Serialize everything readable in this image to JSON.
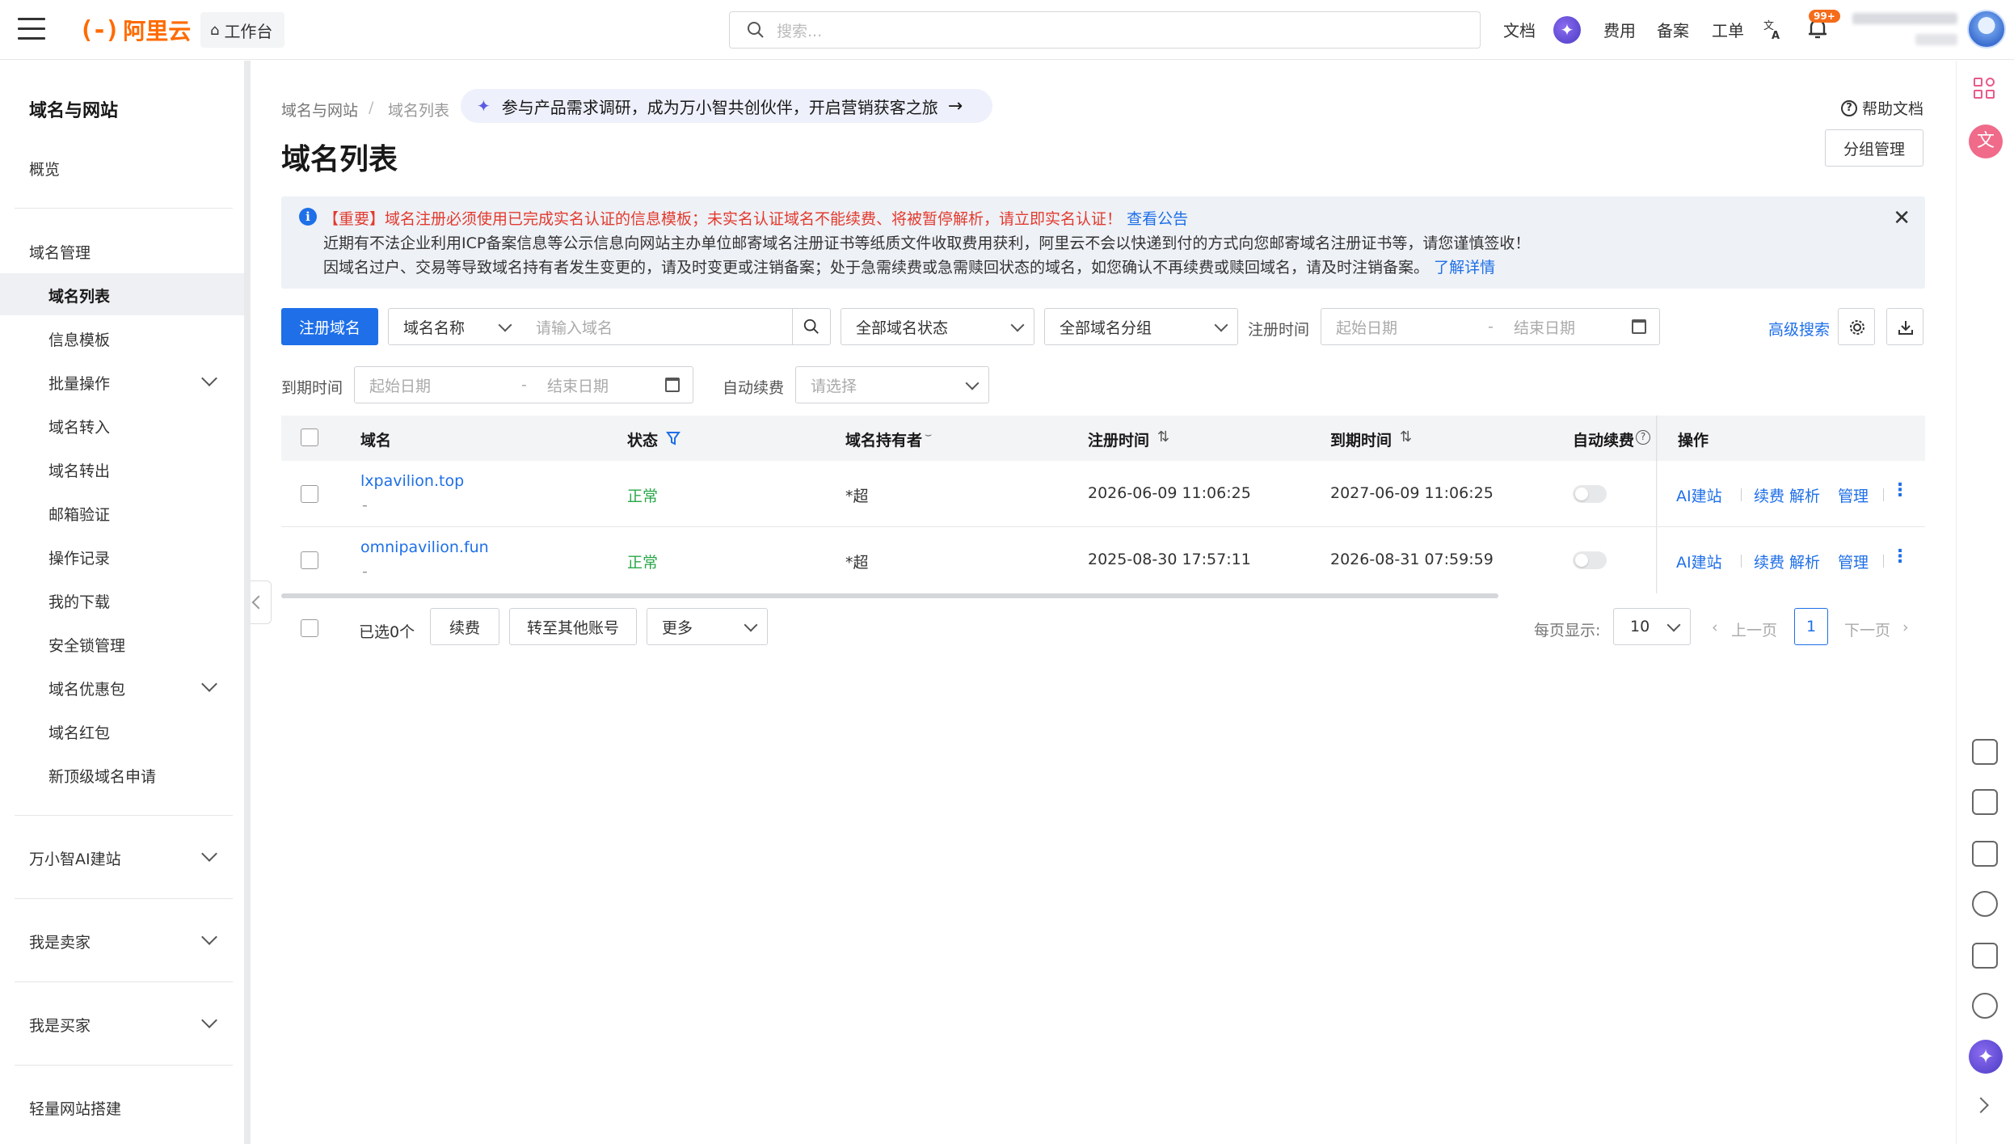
{
  "topbar": {
    "brand": "阿里云",
    "brand_mark": "(-)",
    "workbench": "工作台",
    "search_placeholder": "搜索...",
    "nav": [
      "文档",
      "费用",
      "备案",
      "工单"
    ],
    "bell_badge": "99+"
  },
  "sidebar": {
    "title": "域名与网站",
    "overview": "概览",
    "section_domain": "域名管理",
    "items": [
      "域名列表",
      "信息模板",
      "批量操作",
      "域名转入",
      "域名转出",
      "邮箱验证",
      "操作记录",
      "我的下载",
      "安全锁管理",
      "域名优惠包",
      "域名红包",
      "新顶级域名申请"
    ],
    "groups": [
      "万小智AI建站",
      "我是卖家",
      "我是买家",
      "轻量网站搭建"
    ]
  },
  "main": {
    "breadcrumb": [
      "域名与网站",
      "域名列表"
    ],
    "promo": "参与产品需求调研，成为万小智共创伙伴，开启营销获客之旅",
    "title": "域名列表",
    "help": "帮助文档",
    "group_manage": "分组管理",
    "notice": {
      "line1": "【重要】域名注册必须使用已完成实名认证的信息模板；未实名认证域名不能续费、将被暂停解析，请立即实名认证！",
      "line1_link": "查看公告",
      "line2": "近期有不法企业利用ICP备案信息等公示信息向网站主办单位邮寄域名注册证书等纸质文件收取费用获利，阿里云不会以快递到付的方式向您邮寄域名注册证书等，请您谨慎签收！",
      "line3": "因域名过户、交易等导致域名持有者发生变更的，请及时变更或注销备案；处于急需续费或急需赎回状态的域名，如您确认不再续费或赎回域名，请及时注销备案。",
      "line3_link": "了解详情"
    },
    "filters": {
      "register_btn": "注册域名",
      "search_type": "域名名称",
      "search_placeholder": "请输入域名",
      "status": "全部域名状态",
      "group": "全部域名分组",
      "reg_time_label": "注册时间",
      "start_date": "起始日期",
      "end_date": "结束日期",
      "date_sep": "-",
      "advanced": "高级搜索",
      "expire_label": "到期时间",
      "auto_renew_label": "自动续费",
      "auto_renew_placeholder": "请选择"
    },
    "table": {
      "headers": [
        "域名",
        "状态",
        "域名持有者",
        "注册时间",
        "到期时间",
        "自动续费",
        "操作"
      ],
      "rows": [
        {
          "domain": "lxpavilion.top",
          "sub": "-",
          "status": "正常",
          "owner": "*超",
          "reg": "2026-06-09 11:06:25",
          "exp": "2027-06-09 11:06:25"
        },
        {
          "domain": "omnipavilion.fun",
          "sub": "-",
          "status": "正常",
          "owner": "*超",
          "reg": "2025-08-30 17:57:11",
          "exp": "2026-08-31 07:59:59"
        }
      ],
      "ops": [
        "AI建站",
        "续费",
        "解析",
        "管理"
      ]
    },
    "footer": {
      "selected": "已选0个",
      "renew": "续费",
      "transfer": "转至其他账号",
      "more": "更多",
      "page_size_label": "每页显示:",
      "page_size": "10",
      "prev": "上一页",
      "page": "1",
      "next": "下一页"
    }
  },
  "colors": {
    "brand": "#ff6a00",
    "primary": "#1e6fe8",
    "ok": "#2aa84a",
    "danger": "#e23a2e"
  }
}
